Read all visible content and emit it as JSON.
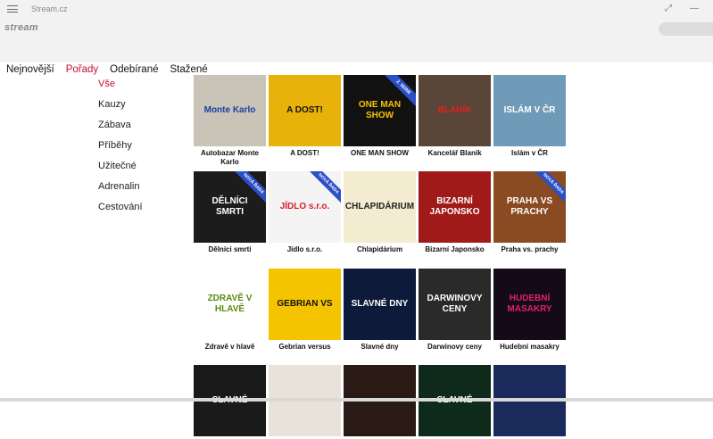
{
  "window": {
    "title": "Stream.cz",
    "minimize": "—",
    "expand": "⤢"
  },
  "app": {
    "logo": "stream"
  },
  "nav": {
    "tabs": [
      {
        "label": "Nejnovější",
        "active": false
      },
      {
        "label": "Pořady",
        "active": true
      },
      {
        "label": "Odebírané",
        "active": false
      },
      {
        "label": "Stažené",
        "active": false
      }
    ]
  },
  "categories": [
    {
      "label": "Vše",
      "active": true
    },
    {
      "label": "Kauzy",
      "active": false
    },
    {
      "label": "Zábava",
      "active": false
    },
    {
      "label": "Příběhy",
      "active": false
    },
    {
      "label": "Užitečné",
      "active": false
    },
    {
      "label": "Adrenalin",
      "active": false
    },
    {
      "label": "Cestování",
      "active": false
    }
  ],
  "shows": [
    {
      "caption": "Autobazar Monte Karlo",
      "thumb_text": "Monte Karlo",
      "bg": "#c9c3b8",
      "fg": "#1a3fa0",
      "ribbon": ""
    },
    {
      "caption": "A DOST!",
      "thumb_text": "A DOST!",
      "bg": "#e8b20a",
      "fg": "#111111",
      "ribbon": ""
    },
    {
      "caption": "ONE MAN SHOW",
      "thumb_text": "ONE MAN SHOW",
      "bg": "#111111",
      "fg": "#f5c400",
      "ribbon": "2. SERIE"
    },
    {
      "caption": "Kancelář Blaník",
      "thumb_text": "BLANÍK",
      "bg": "#5a4638",
      "fg": "#e02020",
      "ribbon": ""
    },
    {
      "caption": "Islám v ČR",
      "thumb_text": "ISLÁM V ČR",
      "bg": "#6f9ab8",
      "fg": "#ffffff",
      "ribbon": ""
    },
    {
      "caption": "Dělníci smrti",
      "thumb_text": "DĚLNÍCI SMRTI",
      "bg": "#1c1c1c",
      "fg": "#ffffff",
      "ribbon": "NOVÁ ŘADA"
    },
    {
      "caption": "Jídlo s.r.o.",
      "thumb_text": "JÍDLO s.r.o.",
      "bg": "#f4f4f4",
      "fg": "#d81e2a",
      "ribbon": "NOVÁ ŘADA"
    },
    {
      "caption": "Chlapidárium",
      "thumb_text": "CHLAPIDÁRIUM",
      "bg": "#f3ecd0",
      "fg": "#222222",
      "ribbon": ""
    },
    {
      "caption": "Bizarní Japonsko",
      "thumb_text": "BIZARNÍ JAPONSKO",
      "bg": "#a01a1a",
      "fg": "#ffffff",
      "ribbon": ""
    },
    {
      "caption": "Praha vs. prachy",
      "thumb_text": "PRAHA VS PRACHY",
      "bg": "#8a4a22",
      "fg": "#ffffff",
      "ribbon": "NOVÁ ŘADA"
    },
    {
      "caption": "Zdravě v hlavě",
      "thumb_text": "ZDRAVĚ V HLAVĚ",
      "bg": "#ffffff",
      "fg": "#5a8a10",
      "ribbon": ""
    },
    {
      "caption": "Gebrian versus",
      "thumb_text": "GEBRIAN VS",
      "bg": "#f5c400",
      "fg": "#111111",
      "ribbon": ""
    },
    {
      "caption": "Slavné dny",
      "thumb_text": "SLAVNÉ DNY",
      "bg": "#0d1a3a",
      "fg": "#ffffff",
      "ribbon": ""
    },
    {
      "caption": "Darwinovy ceny",
      "thumb_text": "DARWINOVY CENY",
      "bg": "#2a2a2a",
      "fg": "#ffffff",
      "ribbon": ""
    },
    {
      "caption": "Hudební masakry",
      "thumb_text": "HUDEBNÍ MASAKRY",
      "bg": "#140a18",
      "fg": "#e0206a",
      "ribbon": ""
    },
    {
      "caption": "",
      "thumb_text": "SLAVNÉ",
      "bg": "#1a1a1a",
      "fg": "#ffffff",
      "ribbon": ""
    },
    {
      "caption": "",
      "thumb_text": "",
      "bg": "#e8e2da",
      "fg": "#333333",
      "ribbon": ""
    },
    {
      "caption": "",
      "thumb_text": "",
      "bg": "#2a1a14",
      "fg": "#ffffff",
      "ribbon": ""
    },
    {
      "caption": "",
      "thumb_text": "SLAVNÉ",
      "bg": "#0d2a1a",
      "fg": "#ffffff",
      "ribbon": ""
    },
    {
      "caption": "",
      "thumb_text": "",
      "bg": "#1a2a5a",
      "fg": "#ffffff",
      "ribbon": ""
    }
  ]
}
